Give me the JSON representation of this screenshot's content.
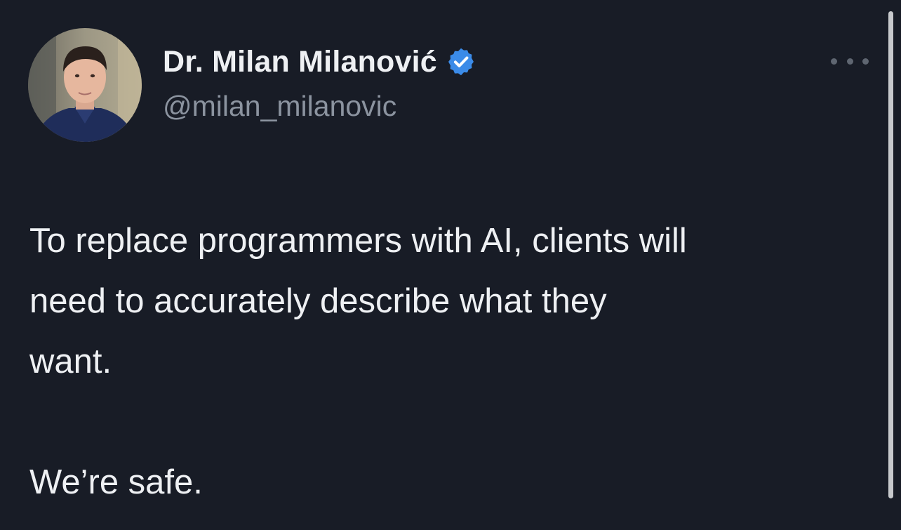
{
  "tweet": {
    "display_name": "Dr. Milan Milanović",
    "handle": "@milan_milanovic",
    "verified": true,
    "avatar_icon": "profile-photo",
    "more_icon": "ellipsis-icon",
    "text_lines": [
      "To replace programmers with AI, clients will",
      "need to accurately describe what they",
      "want."
    ],
    "text_last": "We’re safe."
  },
  "colors": {
    "background": "#181c26",
    "text": "#eef0f3",
    "handle": "#8b939f",
    "verified_badge": "#3b8be8"
  }
}
